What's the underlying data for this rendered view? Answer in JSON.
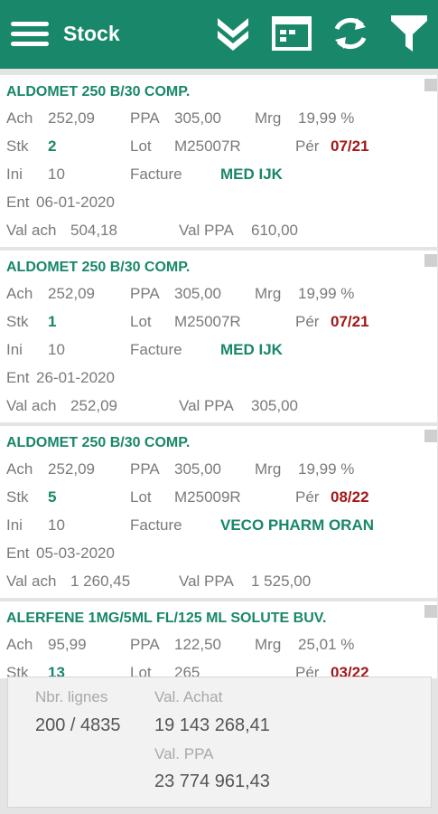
{
  "appbar": {
    "title": "Stock",
    "icons": [
      "menu-icon",
      "double-chevron-down-icon",
      "calendar-icon",
      "refresh-icon",
      "filter-icon"
    ]
  },
  "labels": {
    "ach": "Ach",
    "ppa": "PPA",
    "mrg": "Mrg",
    "stk": "Stk",
    "lot": "Lot",
    "per": "Pér",
    "ini": "Ini",
    "facture": "Facture",
    "ent": "Ent",
    "val_ach": "Val ach",
    "val_ppa": "Val PPA"
  },
  "items": [
    {
      "name": "ALDOMET 250 B/30 COMP.",
      "ach": "252,09",
      "ppa": "305,00",
      "mrg": "19,99 %",
      "stk": "2",
      "lot": "M25007R",
      "per": "07/21",
      "ini": "10",
      "facture": "MED IJK",
      "ent": "06-01-2020",
      "val_ach": "504,18",
      "val_ppa": "610,00"
    },
    {
      "name": "ALDOMET 250 B/30 COMP.",
      "ach": "252,09",
      "ppa": "305,00",
      "mrg": "19,99 %",
      "stk": "1",
      "lot": "M25007R",
      "per": "07/21",
      "ini": "10",
      "facture": "MED IJK",
      "ent": "26-01-2020",
      "val_ach": "252,09",
      "val_ppa": "305,00"
    },
    {
      "name": "ALDOMET 250 B/30 COMP.",
      "ach": "252,09",
      "ppa": "305,00",
      "mrg": "19,99 %",
      "stk": "5",
      "lot": "M25009R",
      "per": "08/22",
      "ini": "10",
      "facture": "VECO PHARM ORAN",
      "ent": "05-03-2020",
      "val_ach": "1 260,45",
      "val_ppa": "1 525,00"
    },
    {
      "name": "ALERFENE 1MG/5ML FL/125 ML SOLUTE BUV.",
      "ach": "95,99",
      "ppa": "122,50",
      "mrg": "25,01 %",
      "stk": "13",
      "lot": "265",
      "per": "03/22",
      "ini": "",
      "facture": "",
      "ent": "",
      "val_ach": "",
      "val_ppa": ""
    }
  ],
  "summary": {
    "nbr_lignes_label": "Nbr. lignes",
    "nbr_lignes_value": "200 / 4835",
    "val_achat_label": "Val. Achat",
    "val_achat_value": "19 143 268,41",
    "val_ppa_label": "Val. PPA",
    "val_ppa_value": "23 774 961,43"
  }
}
